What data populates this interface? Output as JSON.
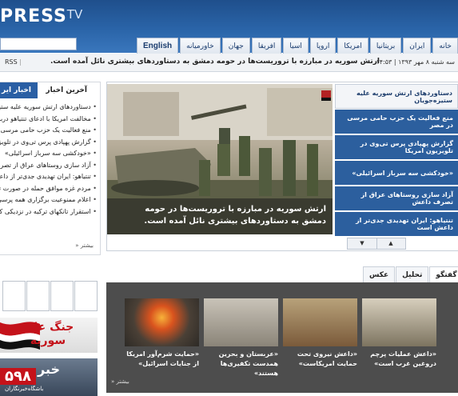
{
  "header": {
    "logo_main": "PRESS",
    "logo_tv": "TV",
    "search_value": "",
    "nav": [
      "خانه",
      "ایران",
      "بریتانیا",
      "امریکا",
      "اروپا",
      "اسیا",
      "افریقا",
      "جهان",
      "خاورمیانه",
      "English"
    ]
  },
  "ticker": {
    "date": "سه شنبه ۸ مهر ۱۳۹۳ | ۱۴:۵۳",
    "headline": "ارتش سوریه در مبارزه با تروریست‌ها در حومه دمشق به دستاوردهای بیشتری نائل آمده است.",
    "rss": "RSS"
  },
  "latest": {
    "tab_latest": "آخرین اخبار",
    "tab_iran": "اخبار ایر",
    "items": [
      "دستاوردهای ارتش سوریه علیه ستیزه‌جویان",
      "مخالفت امریکا با ادعای تنتیاهو درباره",
      "منع فعالیت یک حزب حامی مرسی در",
      "گزارش پهپادی پرس تی‌وی در تلویزیون",
      "«خودکشی سه سرباز اسرائیلی»",
      "آزاد سازی روستاهای عراق از تصرف",
      "تنتیاهو: ایران تهدیدی جدی‌تر از داعش",
      "مردم غزه موافق حمله در صورت تداوم",
      "اعلام ممنوعیت برگزاری همه پرسی",
      "استقرار تانکهای ترکیه در نزدیکی کو"
    ],
    "more": "» بیشتر"
  },
  "slider": {
    "caption": "ارتش سوریه در مبارزه با تروریست‌ها در حومه دمشق به دستاوردهای بیشتری نائل آمده است.",
    "items": [
      "دستاوردهای ارتش سوریه علیه ستیزه‌جویان",
      "منع فعالیت یک حزب حامی مرسی در مصر",
      "گزارش پهپادی پرس تی‌وی در تلویزیون امریکا",
      "«خودکشی سه سرباز اسرائیلی»",
      "آزاد سازی روستاهای عراق از تصرف داعش",
      "تنتیاهو: ایران تهدیدی جدی‌تر از داعش است"
    ],
    "arrow_up": "▲",
    "arrow_down": "▼"
  },
  "gallery": {
    "tabs": [
      "گفتگو",
      "تحلیل",
      "عکس روز"
    ],
    "items": [
      "«داعش عملیات پرچم دروغین غرب است»",
      "«داعش نیروی تحت حمایت امریکاست»",
      "«عربستان و بحرین همدست تکفیری‌ها هستند»",
      "«حمایت شرم‌آور امریکا از جنایات اسرائیل»"
    ],
    "more": "» بیشتر"
  },
  "ads": {
    "syria_line1": "جنگ علیه",
    "syria_line2": "سوریه",
    "khabar": "خبر",
    "khabar_badge": "۵۹۸",
    "khabar_sub": "باشگاه‌خبرنگاران"
  },
  "colors": {
    "header_blue": "#2a64a8",
    "slide_blue": "#2c5f9e",
    "gallery_bg": "#4d4d4d",
    "syria_red": "#c4121a"
  }
}
